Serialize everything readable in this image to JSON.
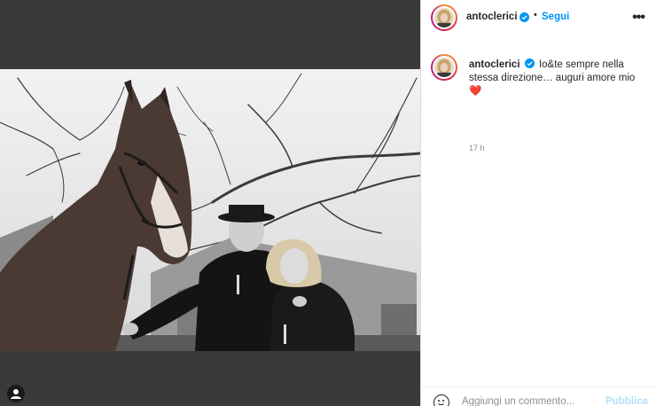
{
  "post": {
    "username": "antoclerici",
    "follow_label": "Segui",
    "separator": "•",
    "more_label": "•••",
    "caption_text": "Io&te sempre nella stessa direzione… auguri amore mio",
    "heart_emoji": "❤️",
    "time_ago": "17 h"
  },
  "comment_box": {
    "placeholder": "Aggiungi un commento...",
    "publish_label": "Pubblica"
  },
  "colors": {
    "accent": "#0095f6",
    "publish_disabled": "#b2dffc",
    "left_panel_bg": "#3a3a3a"
  },
  "icons": [
    "verified-badge-icon",
    "more-options-icon",
    "emoji-icon",
    "user-tag-icon"
  ]
}
